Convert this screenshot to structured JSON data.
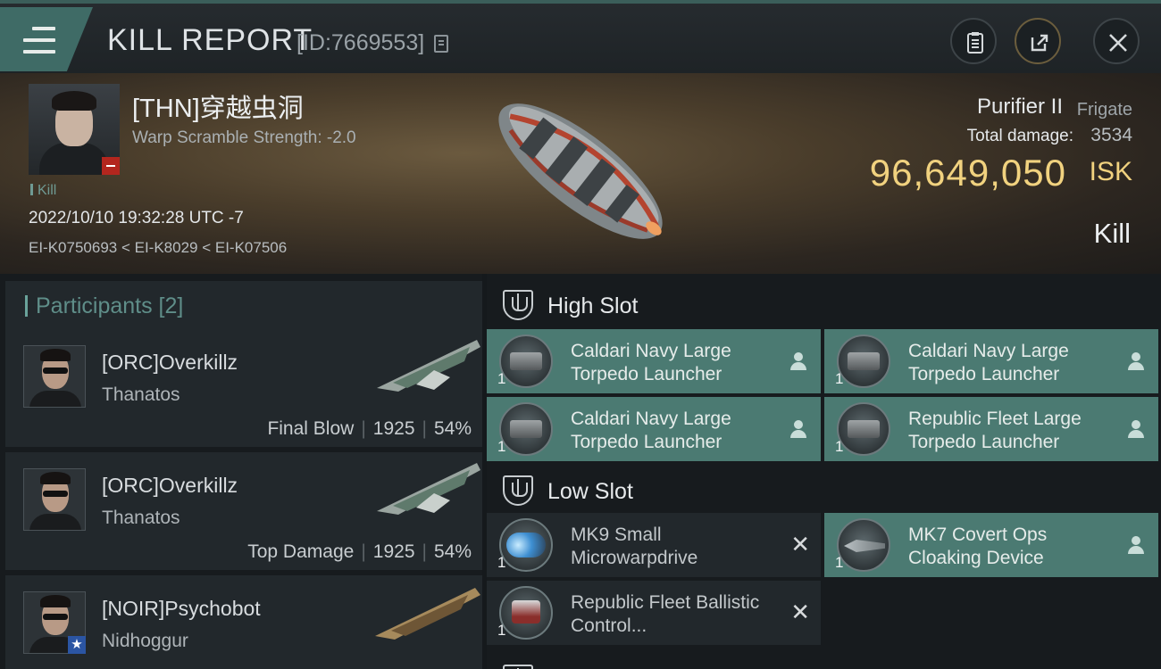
{
  "header": {
    "title": "KILL REPORT",
    "report_id": "[ID:7669553]",
    "icons": {
      "menu": "hamburger-icon",
      "copy": "copy-icon",
      "clipboard": "clipboard-icon",
      "share": "share-icon",
      "close": "close-icon"
    }
  },
  "victim": {
    "name": "[THN]穿越虫洞",
    "warp_scramble": "Warp Scramble Strength: -2.0",
    "tag": "Kill",
    "datetime": "2022/10/10 19:32:28 UTC -7",
    "systems": "EI-K0750693 < EI-K8029 < EI-K07506",
    "ship_name": "Purifier II",
    "ship_class": "Frigate",
    "damage_label": "Total damage:",
    "damage_value": "3534",
    "isk_value": "96,649,050",
    "isk_unit": "ISK",
    "result": "Kill"
  },
  "participants": {
    "header": "Participants [2]",
    "rows": [
      {
        "name": "[ORC]Overkillz",
        "ship": "Thanatos",
        "role": "Final Blow",
        "damage": "1925",
        "percent": "54%"
      },
      {
        "name": "[ORC]Overkillz",
        "ship": "Thanatos",
        "role": "Top Damage",
        "damage": "1925",
        "percent": "54%"
      },
      {
        "name": "[NOIR]Psychobot",
        "ship": "Nidhoggur"
      }
    ]
  },
  "fitting": {
    "high_slot": {
      "title": "High Slot",
      "modules": [
        {
          "qty": "1",
          "name": "Caldari Navy Large Torpedo Launcher"
        },
        {
          "qty": "1",
          "name": "Caldari Navy Large Torpedo Launcher"
        },
        {
          "qty": "1",
          "name": "Caldari Navy Large Torpedo Launcher"
        },
        {
          "qty": "1",
          "name": "Republic Fleet Large Torpedo Launcher"
        }
      ]
    },
    "low_slot": {
      "title": "Low Slot",
      "modules": [
        {
          "qty": "1",
          "name": "MK9 Small Microwarpdrive",
          "status": "destroyed"
        },
        {
          "qty": "1",
          "name": "MK7 Covert Ops Cloaking Device",
          "status": "dropped"
        },
        {
          "qty": "1",
          "name": "Republic Fleet Ballistic Control...",
          "status": "destroyed"
        }
      ]
    }
  },
  "colors": {
    "accent": "#4b7a72",
    "isk": "#f1d27f",
    "badge_red": "#b3261e",
    "badge_blue": "#2b55a3"
  }
}
